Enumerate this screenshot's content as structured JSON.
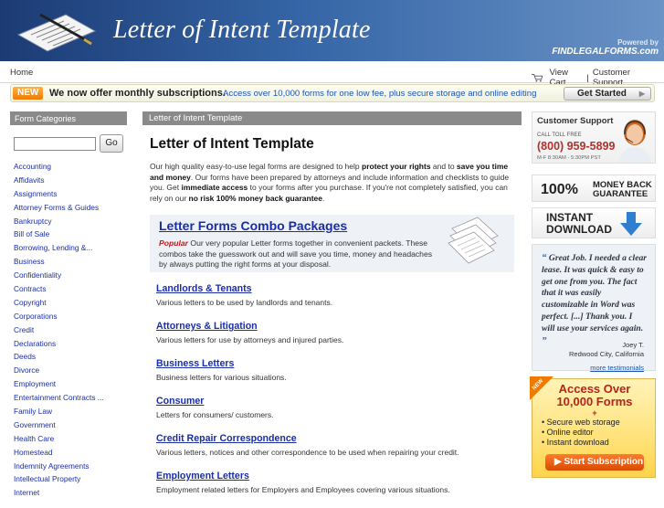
{
  "header": {
    "site_title": "Letter of Intent Template",
    "powered_by": "Powered by",
    "brand": "FINDLEGALFORMS.com"
  },
  "topnav": {
    "home": "Home",
    "view_cart": "View Cart",
    "separator": "|",
    "customer_support": "Customer Support"
  },
  "promo": {
    "badge": "NEW",
    "headline": "We now offer monthly subscriptions.",
    "subtext": "Access over 10,000 forms for one low fee, plus secure storage and online editing",
    "button": "Get Started",
    "button_arrow": "▶"
  },
  "sidebar": {
    "heading": "Form Categories",
    "search_placeholder": "",
    "go_label": "Go",
    "categories": [
      "Accounting",
      "Affidavits",
      "Assignments",
      "Attorney Forms & Guides",
      "Bankruptcy",
      "Bill of Sale",
      "Borrowing, Lending &...",
      "Business",
      "Confidentiality",
      "Contracts",
      "Copyright",
      "Corporations",
      "Credit",
      "Declarations",
      "Deeds",
      "Divorce",
      "Employment",
      "Entertainment Contracts ...",
      "Family Law",
      "Government",
      "Health Care",
      "Homestead",
      "Indemnity Agreements",
      "Intellectual Property",
      "Internet"
    ]
  },
  "main": {
    "breadcrumb": "Letter of Intent Template",
    "title": "Letter of Intent Template",
    "intro": {
      "p1": "Our high quality easy-to-use legal forms are designed to help ",
      "b1": "protect your rights",
      "p2": " and to ",
      "b2": "save you time and money",
      "p3": ". Our forms have been prepared by attorneys and include information and checklists to guide you. Get ",
      "b3": "immediate access",
      "p4": " to your forms after you purchase. If you're not completely satisfied, you can rely on our ",
      "b4": "no risk 100% money back guarantee",
      "p5": "."
    },
    "combo": {
      "title": "Letter Forms Combo Packages",
      "popular": "Popular",
      "desc": " Our very popular Letter forms together in convenient packets. These combos take the guesswork out and will save you time, money and headaches by always putting the right forms at your disposal."
    },
    "sections": [
      {
        "title": "Landlords & Tenants",
        "desc": "Various letters to be used by landlords and tenants."
      },
      {
        "title": "Attorneys & Litigation",
        "desc": "Various letters for use by attorneys and injured parties."
      },
      {
        "title": "Business Letters",
        "desc": "Business letters for various situations."
      },
      {
        "title": "Consumer",
        "desc": "Letters for consumers/ customers."
      },
      {
        "title": "Credit Repair Correspondence",
        "desc": "Various letters, notices and other correspondence to be used when repairing your credit."
      },
      {
        "title": "Employment Letters",
        "desc": "Employment related letters for Employers and Employees covering various situations."
      }
    ]
  },
  "right": {
    "cs_title": "Customer Support",
    "call_label": "CALL TOLL FREE",
    "phone": "(800) 959-5899",
    "hours": "M-F 8:30AM - 5:30PM PST",
    "money_pct": "100%",
    "money_l1": "MONEY BACK",
    "money_l2": "GUARANTEE",
    "instant_l1": "INSTANT",
    "instant_l2": "DOWNLOAD",
    "quote_open": "“",
    "quote": "Great Job. I needed a clear lease. It was quick & easy to get one from you. The fact that it was easily customizable in Word was perfect. [...] Thank you. I will use your services again.",
    "quote_close": "”",
    "author": "Joey T.",
    "location": "Redwood City, California",
    "more": "more testimonials",
    "sub_l1": "Access Over",
    "sub_l2": "10,000 Forms",
    "sub_plus": "+",
    "sub_items": [
      "• Secure web storage",
      "• Online editor",
      "• Instant download"
    ],
    "sub_button": "▶ Start Subscription",
    "sub_tag": "NEW"
  },
  "colors": {
    "header_blue": "#2a528f",
    "link": "#1a2ea8",
    "accent_red": "#b3312b",
    "promo_orange": "#f07a00"
  }
}
